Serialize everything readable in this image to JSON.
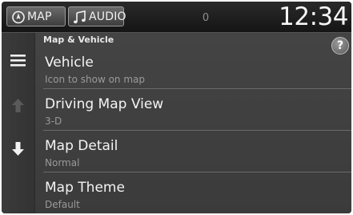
{
  "topbar": {
    "map_label": "MAP",
    "audio_label": "AUDIO",
    "message_count": "0",
    "clock": "12:34"
  },
  "section": {
    "title": "Map & Vehicle",
    "help_label": "?"
  },
  "items": [
    {
      "title": "Vehicle",
      "value": "Icon to show on map"
    },
    {
      "title": "Driving Map View",
      "value": "3-D"
    },
    {
      "title": "Map Detail",
      "value": "Normal"
    },
    {
      "title": "Map Theme",
      "value": "Default"
    }
  ],
  "icons": {
    "map": "navigation-compass-icon",
    "audio": "music-note-icon",
    "menu": "hamburger-menu-icon",
    "scroll_up": "arrow-up-icon",
    "scroll_down": "arrow-down-icon"
  }
}
